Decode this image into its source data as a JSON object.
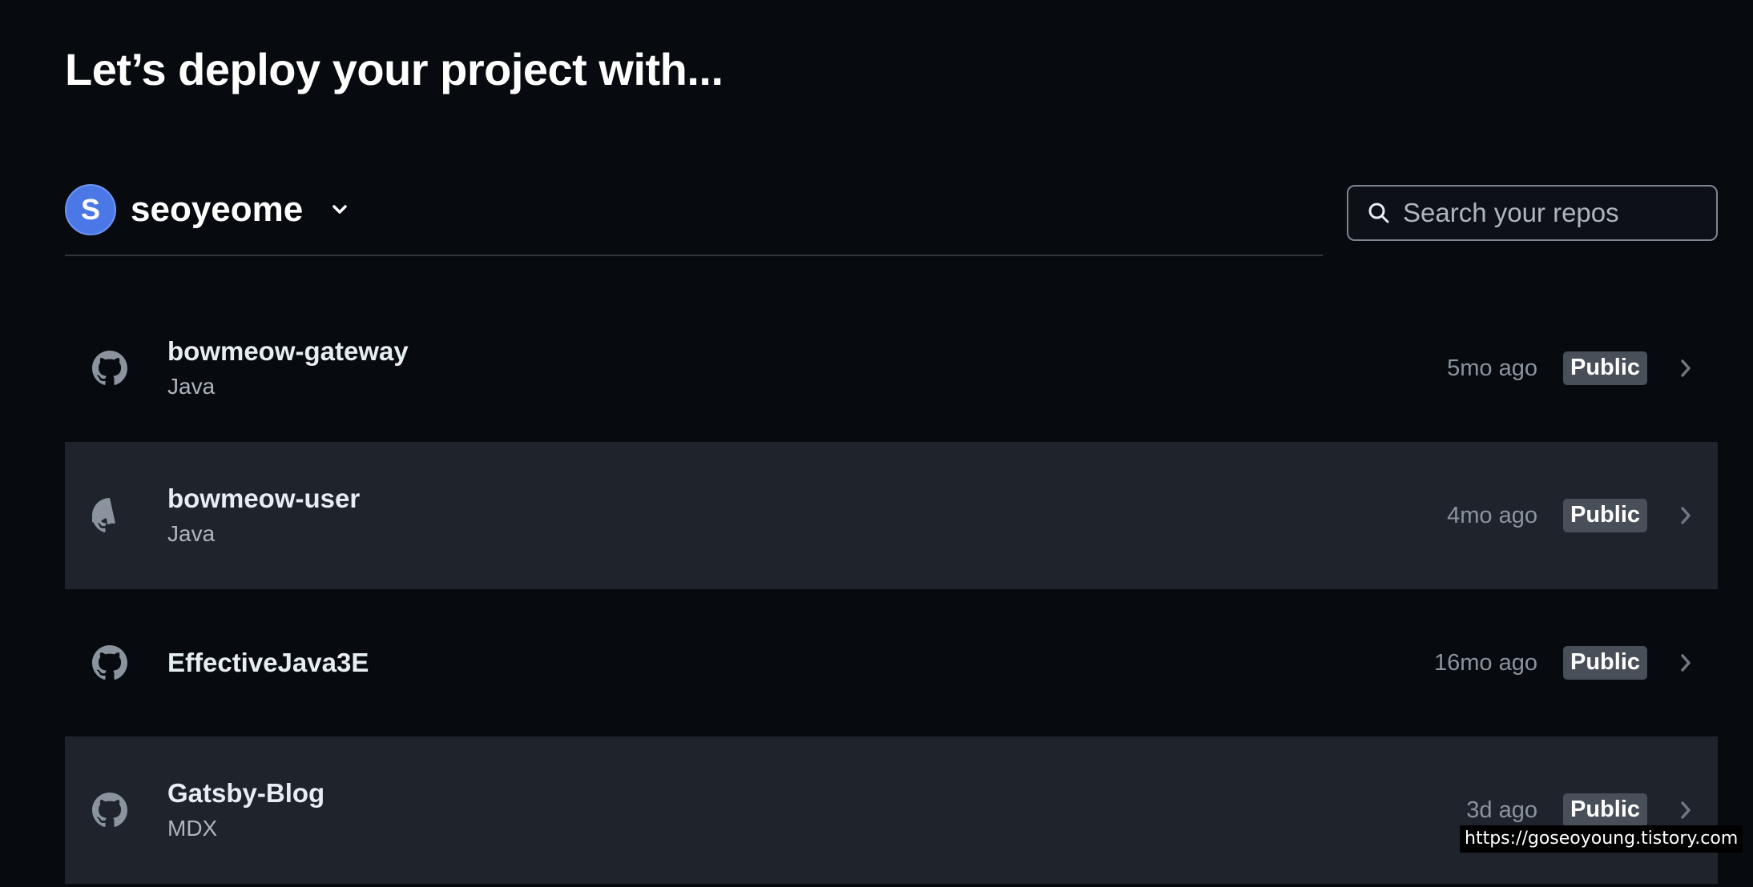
{
  "heading": "Let’s deploy your project with...",
  "account": {
    "avatar_letter": "S",
    "name": "seoyeome",
    "avatar_color": "#4b78e6"
  },
  "search": {
    "placeholder": "Search your repos",
    "value": ""
  },
  "repos": [
    {
      "name": "bowmeow-gateway",
      "language": "Java",
      "updated": "5mo ago",
      "visibility": "Public"
    },
    {
      "name": "bowmeow-user",
      "language": "Java",
      "updated": "4mo ago",
      "visibility": "Public"
    },
    {
      "name": "EffectiveJava3E",
      "language": "",
      "updated": "16mo ago",
      "visibility": "Public"
    },
    {
      "name": "Gatsby-Blog",
      "language": "MDX",
      "updated": "3d ago",
      "visibility": "Public"
    }
  ],
  "watermark": "https://goseoyoung.tistory.com",
  "colors": {
    "background": "#070b10",
    "row_alt_background": "#1f242c",
    "badge_background": "#484f58"
  },
  "icons": {
    "repo": "github-icon",
    "search": "search-icon",
    "account_menu": "chevron-down-icon",
    "row_arrow": "chevron-right-icon"
  }
}
